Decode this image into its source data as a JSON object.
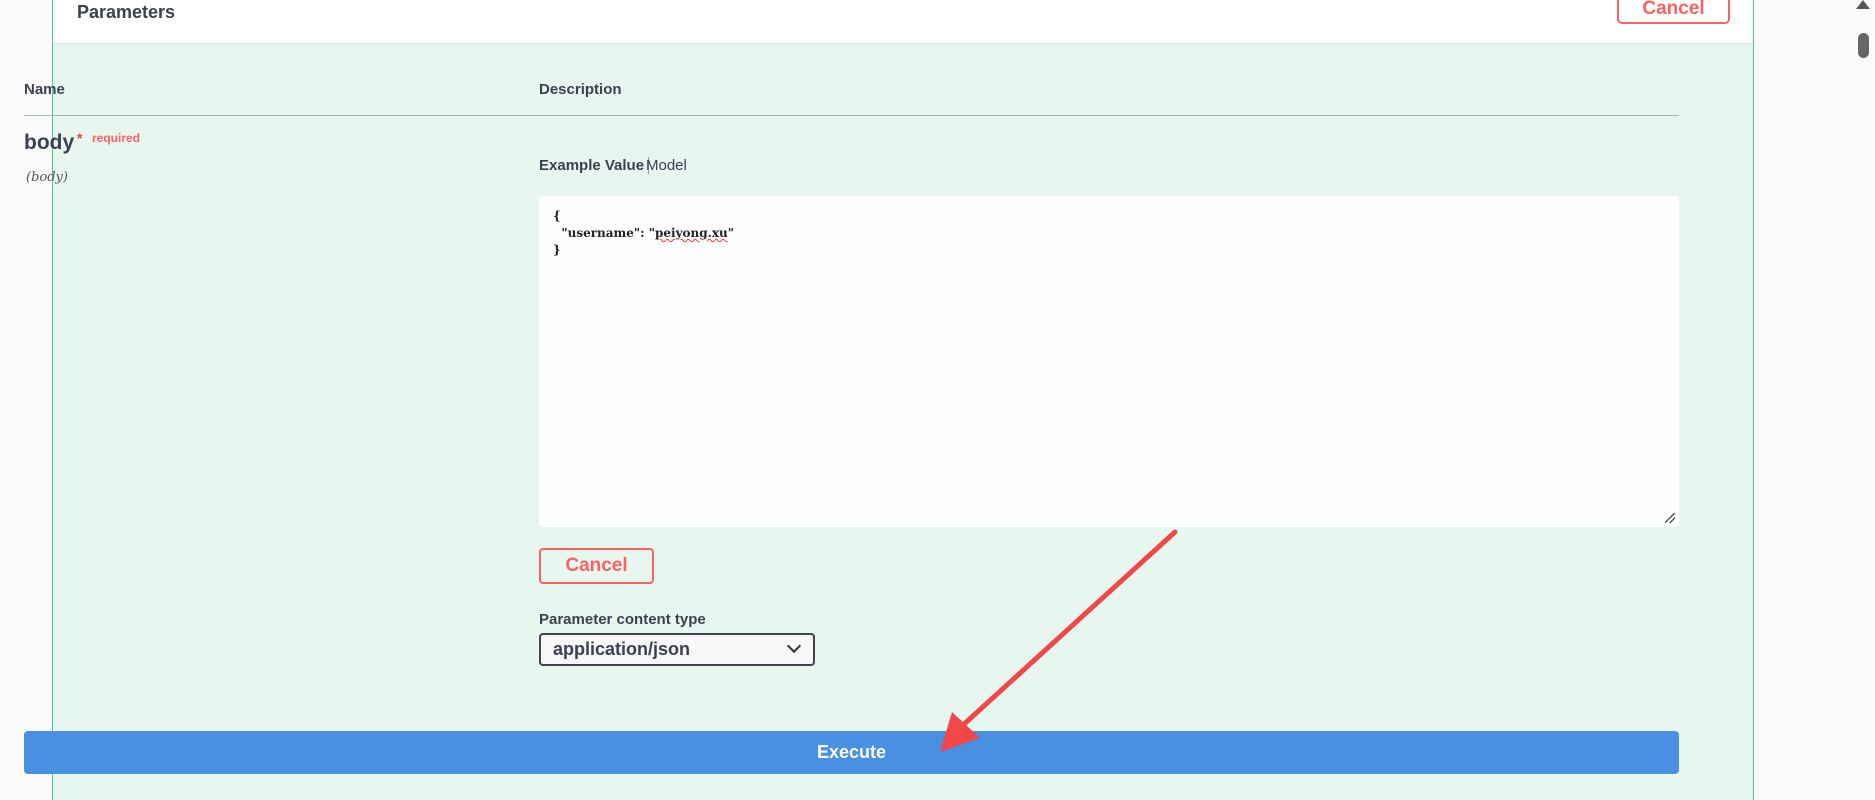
{
  "section": {
    "title": "Parameters",
    "cancel_label": "Cancel"
  },
  "table": {
    "headers": {
      "name": "Name",
      "description": "Description"
    }
  },
  "param": {
    "name": "body",
    "star": "*",
    "required_label": "required",
    "in": "(body)"
  },
  "example_tabs": {
    "example_value": "Example Value",
    "model": "Model"
  },
  "body_value": {
    "open": "{",
    "line_key": "  \"username\": \"",
    "line_value": "peiyong.xu",
    "line_end": "\"",
    "close": "}"
  },
  "cancel_button_label": "Cancel",
  "content_type": {
    "label": "Parameter content type",
    "selected": "application/json"
  },
  "execute_label": "Execute",
  "colors": {
    "accent_green": "#49cc90",
    "panel_bg": "#e8f6f0",
    "cancel_red": "#ff6060",
    "execute_blue": "#4990e2",
    "annotation_arrow": "#f04848"
  }
}
